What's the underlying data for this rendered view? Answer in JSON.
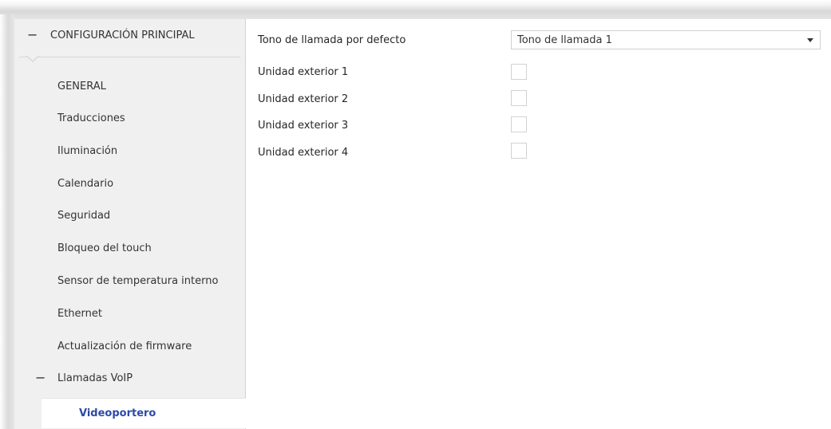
{
  "sidebar": {
    "header": {
      "label": "CONFIGURACIÓN PRINCIPAL",
      "collapse_symbol": "−"
    },
    "items": [
      {
        "label": "GENERAL"
      },
      {
        "label": "Traducciones"
      },
      {
        "label": "Iluminación"
      },
      {
        "label": "Calendario"
      },
      {
        "label": "Seguridad"
      },
      {
        "label": "Bloqueo del touch"
      },
      {
        "label": "Sensor de temperatura interno"
      },
      {
        "label": "Ethernet"
      },
      {
        "label": "Actualización de firmware"
      }
    ],
    "voip": {
      "label": "Llamadas VoIP",
      "collapse_symbol": "−"
    },
    "selected": {
      "label": "Videoportero"
    },
    "selected_color": "#2b4aa8"
  },
  "main": {
    "ringtone": {
      "label": "Tono de llamada por defecto",
      "value": "Tono de llamada 1"
    },
    "outdoor_units": [
      {
        "label": "Unidad exterior 1",
        "checked": false
      },
      {
        "label": "Unidad exterior 2",
        "checked": false
      },
      {
        "label": "Unidad exterior 3",
        "checked": false
      },
      {
        "label": "Unidad exterior 4",
        "checked": false
      }
    ]
  }
}
